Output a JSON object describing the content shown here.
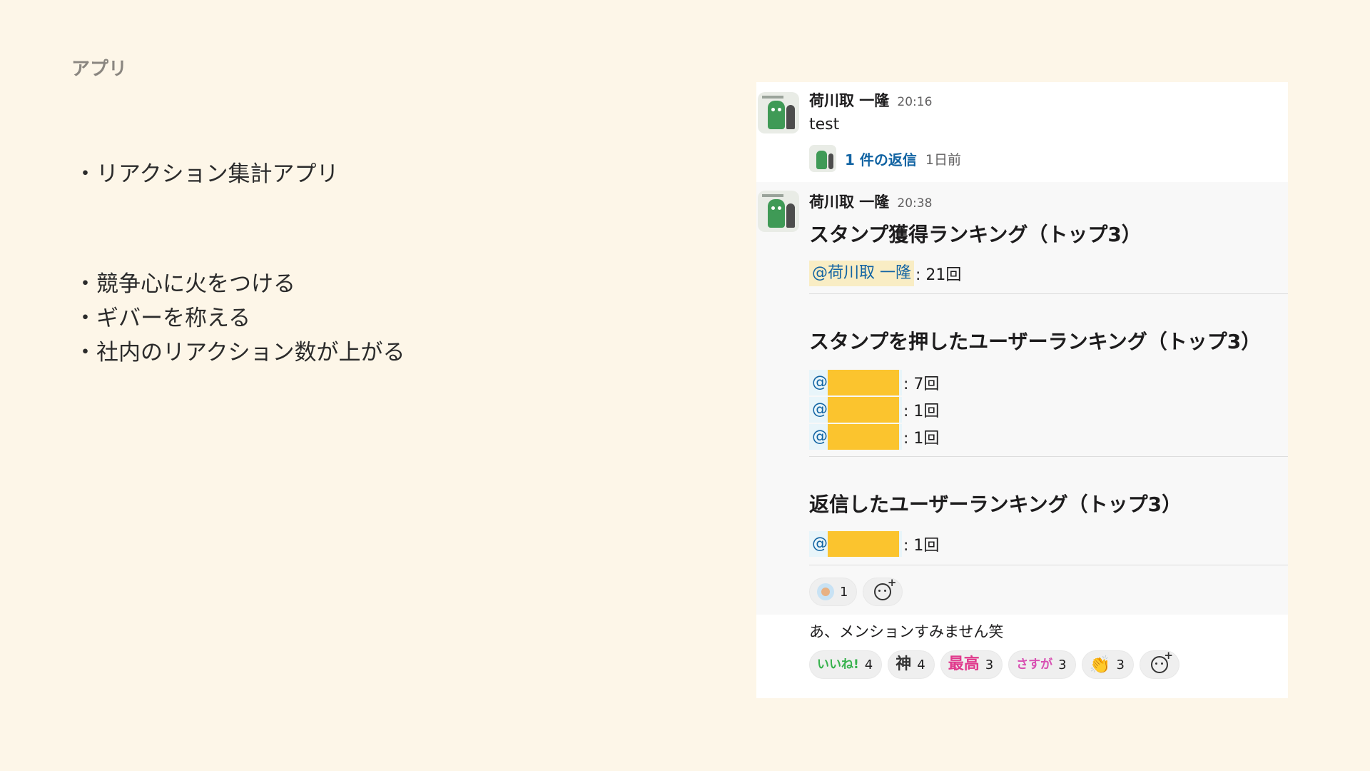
{
  "slide": {
    "section_title": "アプリ",
    "bullets_primary": [
      "・リアクション集計アプリ"
    ],
    "bullets_secondary": [
      "・競争心に火をつける",
      "・ギバーを称える",
      "・社内のリアクション数が上がる"
    ]
  },
  "slack": {
    "message1": {
      "author": "荷川取 一隆",
      "time": "20:16",
      "text": "test",
      "thread": {
        "replies": "1 件の返信",
        "ago": "1日前"
      }
    },
    "message2": {
      "author": "荷川取 一隆",
      "time": "20:38",
      "sections": [
        {
          "title": "スタンプ獲得ランキング（トップ3）",
          "rows": [
            {
              "mention": "@荷川取 一隆",
              "count": ": 21回"
            }
          ]
        },
        {
          "title": "スタンプを押したユーザーランキング（トップ3）",
          "rows": [
            {
              "mention": "@",
              "count": ": 7回"
            },
            {
              "mention": "@",
              "count": ": 1回"
            },
            {
              "mention": "@",
              "count": ": 1回"
            }
          ]
        },
        {
          "title": "返信したユーザーランキング（トップ3）",
          "rows": [
            {
              "mention": "@",
              "count": ": 1回"
            }
          ]
        }
      ],
      "reactions": [
        {
          "emoji": "person-emoji",
          "count": "1"
        }
      ]
    },
    "message3": {
      "text": "あ、メンションすみません笑",
      "reactions": [
        {
          "emoji": "いいね!",
          "count": "4"
        },
        {
          "emoji": "神",
          "count": "4"
        },
        {
          "emoji": "最高",
          "count": "3"
        },
        {
          "emoji": "さすが",
          "count": "3"
        },
        {
          "emoji": "👏",
          "count": "3"
        }
      ]
    }
  },
  "colors": {
    "slide_bg": "#fdf6e8",
    "mention_text": "#1264a3",
    "mention_bg": "#e8f5fa",
    "self_mention_bg": "#f9edc4",
    "redaction": "#fbc42e"
  }
}
